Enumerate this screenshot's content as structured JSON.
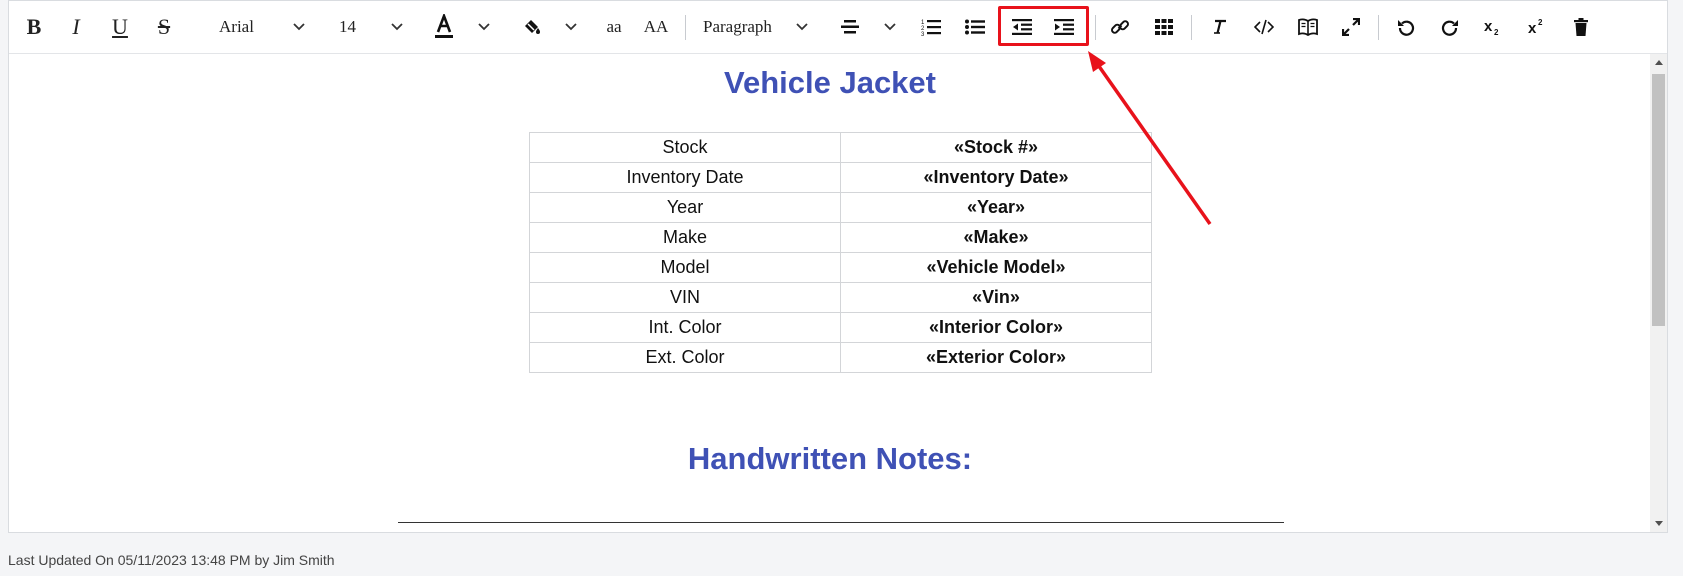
{
  "toolbar": {
    "font_family": "Arial",
    "font_size": "14",
    "lowercase_label": "aa",
    "uppercase_label": "AA",
    "block_format": "Paragraph"
  },
  "document": {
    "title": "Vehicle Jacket",
    "rows": [
      {
        "label": "Stock",
        "value": "«Stock #»"
      },
      {
        "label": "Inventory Date",
        "value": "«Inventory Date»"
      },
      {
        "label": "Year",
        "value": "«Year»"
      },
      {
        "label": "Make",
        "value": "«Make»"
      },
      {
        "label": "Model",
        "value": "«Vehicle Model»"
      },
      {
        "label": "VIN",
        "value": "«Vin»"
      },
      {
        "label": "Int. Color",
        "value": "«Interior Color»"
      },
      {
        "label": "Ext. Color",
        "value": "«Exterior Color»"
      }
    ],
    "notes_heading": "Handwritten Notes:"
  },
  "footer": {
    "status": "Last Updated On 05/11/2023 13:48 PM by Jim Smith"
  },
  "colors": {
    "heading": "#3f51b5",
    "annotation": "#e8121b"
  }
}
